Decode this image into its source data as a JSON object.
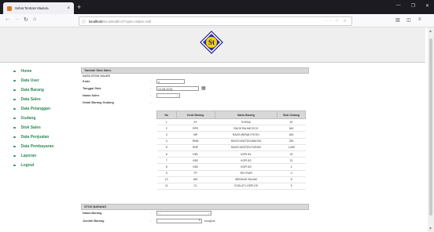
{
  "browser": {
    "tab_title": "Sehat Tentram Madura",
    "url_host": "localhost",
    "url_path": "/sis-sekolah-2/?open=Sales-Add"
  },
  "logo_text": "St",
  "menu": [
    {
      "label": "Home"
    },
    {
      "label": "Data User"
    },
    {
      "label": "Data Barang"
    },
    {
      "label": "Data Sales"
    },
    {
      "label": "Data Pelanggan"
    },
    {
      "label": "Gudang"
    },
    {
      "label": "Stok Sales"
    },
    {
      "label": "Data Penjualan"
    },
    {
      "label": "Data Pembayaran"
    },
    {
      "label": "Laporan"
    },
    {
      "label": "Logout"
    }
  ],
  "form": {
    "section_title": "Tambah Stok Sales",
    "subsection_title": "DATA STOK SALES",
    "kode_label": "Kode",
    "kode_value": "4",
    "tanggal_label": "Tanggal Stok",
    "tanggal_value": "23-08-2018",
    "nama_sales_label": "Nama Sales",
    "nama_sales_value": "....",
    "detail_label": "Detail Barang Gudang",
    "colon": ":"
  },
  "detail_table": {
    "headers": [
      "No",
      "Kode Barang",
      "Nama Barang",
      "Stok Gudang"
    ],
    "rows": [
      [
        "1",
        "SY",
        "SYIFAA",
        "40"
      ],
      [
        "2",
        "RPE",
        "RAOS PALING ECO",
        "542"
      ],
      [
        "3",
        "MP",
        "RAOS MERAH PUTIH",
        "620"
      ],
      [
        "4",
        "RNM",
        "RAOS NGETEN MAKON",
        "250"
      ],
      [
        "5",
        "RNP",
        "RAOS NGETEN PURON",
        "1,659"
      ],
      [
        "6",
        "KB1",
        "KOPI B1",
        "20"
      ],
      [
        "7",
        "KB2",
        "KOPI B2",
        "21"
      ],
      [
        "8",
        "KB3",
        "KOPI B3",
        "2"
      ],
      [
        "9",
        "TP",
        "TEH PURI",
        "0"
      ],
      [
        "10",
        "WS",
        "WEDANG SALAM",
        "5"
      ],
      [
        "11",
        "CL",
        "COKLAT LOSPLOS",
        "5"
      ]
    ]
  },
  "stok_barang": {
    "title": "STOK BARANG",
    "nama_barang_label": "Nama Barang",
    "nama_barang_value": "....",
    "jumlah_label": "Jumlah Barang",
    "satuan": "bungkus"
  }
}
